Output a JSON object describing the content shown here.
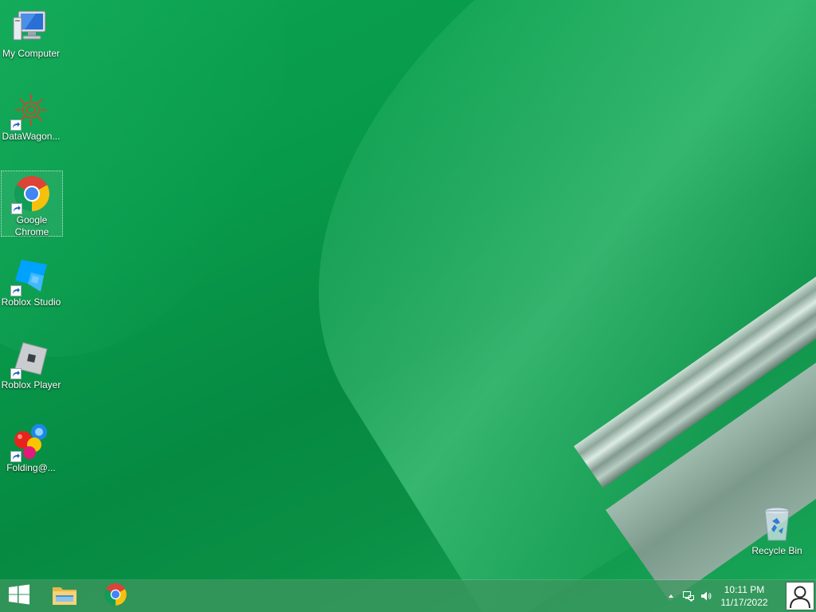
{
  "desktop": {
    "icons": [
      {
        "label": "My Computer",
        "icon": "computer-icon"
      },
      {
        "label": "DataWagon...",
        "icon": "datawagon-gear-icon",
        "shortcut": true
      },
      {
        "label": "Google Chrome",
        "icon": "chrome-icon",
        "shortcut": true,
        "selected": true
      },
      {
        "label": "Roblox Studio",
        "icon": "roblox-studio-icon",
        "shortcut": true
      },
      {
        "label": "Roblox Player",
        "icon": "roblox-player-icon",
        "shortcut": true
      },
      {
        "label": "Folding@...",
        "icon": "folding-at-home-icon",
        "shortcut": true
      },
      {
        "label": "Recycle Bin",
        "icon": "recycle-bin-icon"
      }
    ]
  },
  "taskbar": {
    "start_icon": "windows-logo-icon",
    "pinned": [
      {
        "icon": "file-explorer-icon"
      },
      {
        "icon": "chrome-icon"
      }
    ],
    "tray": {
      "icons": [
        "show-hidden-icons-chevron-icon",
        "network-icon",
        "volume-icon"
      ]
    },
    "clock": {
      "time": "10:11 PM",
      "date": "11/17/2022"
    },
    "user_icon": "user-account-icon"
  },
  "colors": {
    "wallpaper_green": "#089a4b",
    "taskbar": "#3c965f"
  }
}
